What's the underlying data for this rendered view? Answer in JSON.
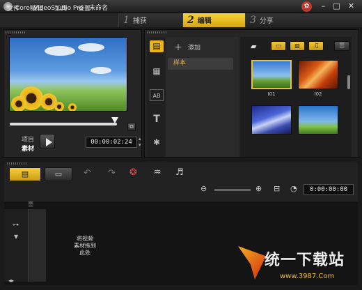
{
  "app": {
    "title": "Corel VideoStudio Pro - 未命名"
  },
  "menu": [
    "文件",
    "编辑",
    "工具",
    "设置"
  ],
  "steps": [
    {
      "num": "1",
      "label": "捕获"
    },
    {
      "num": "2",
      "label": "编辑"
    },
    {
      "num": "3",
      "label": "分享"
    }
  ],
  "preview": {
    "mode_label_1": "项目",
    "mode_label_2": "素材",
    "timecode": "00:00:02:24"
  },
  "library": {
    "add_label": "添加",
    "sample_label": "样本",
    "thumbs": [
      {
        "label": "I01"
      },
      {
        "label": "I02"
      },
      {
        "label": ""
      },
      {
        "label": ""
      }
    ]
  },
  "tool_glyphs": {
    "title_glyph": "T",
    "ab_glyph": "AB"
  },
  "timeline": {
    "timecode": "0:00:00:00",
    "drop_hint": "将视频\n素材拖到\n此处"
  },
  "watermark": {
    "brand": "统一下载站",
    "url": "www.3987.Com"
  },
  "colors": {
    "accent": "#e8b417",
    "bg": "#1a1a1a"
  }
}
